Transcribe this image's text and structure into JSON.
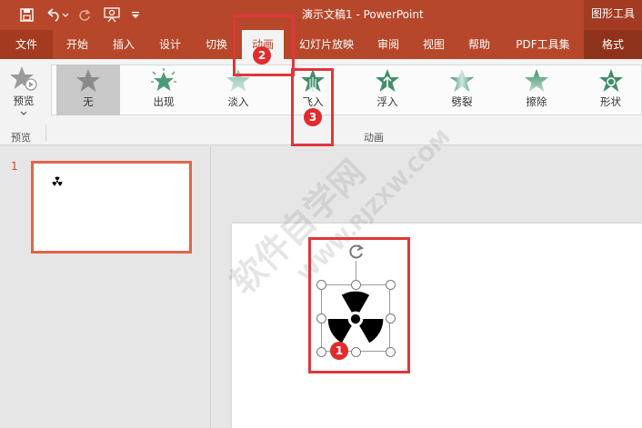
{
  "titlebar": {
    "doc_title": "演示文稿1  -  PowerPoint",
    "context_tools": "图形工具"
  },
  "qat": {
    "save_icon": "save-icon",
    "undo_icon": "undo-icon",
    "redo_icon": "redo-icon",
    "present_icon": "present-from-start-icon",
    "customize_icon": "customize-qat-icon"
  },
  "tabs": [
    {
      "label": "文件"
    },
    {
      "label": "开始"
    },
    {
      "label": "插入"
    },
    {
      "label": "设计"
    },
    {
      "label": "切换"
    },
    {
      "label": "动画"
    },
    {
      "label": "幻灯片放映"
    },
    {
      "label": "审阅"
    },
    {
      "label": "视图"
    },
    {
      "label": "帮助"
    },
    {
      "label": "PDF工具集"
    },
    {
      "label": "格式"
    }
  ],
  "ribbon": {
    "preview_label": "预览",
    "preview_group": "预览",
    "animation_group": "动画",
    "effects": [
      {
        "label": "无",
        "color": "#8a8a8a"
      },
      {
        "label": "出现",
        "color": "#4e9a78"
      },
      {
        "label": "淡入",
        "color": "#86c1a4"
      },
      {
        "label": "飞入",
        "color": "#3f8f6b"
      },
      {
        "label": "浮入",
        "color": "#3f8f6b"
      },
      {
        "label": "劈裂",
        "color": "#3f8f6b"
      },
      {
        "label": "擦除",
        "color": "#5aa383"
      },
      {
        "label": "形状",
        "color": "#3f8f6b"
      }
    ]
  },
  "slides": [
    {
      "number": "1"
    }
  ],
  "markers": {
    "m1": "1",
    "m2": "2",
    "m3": "3"
  },
  "watermark": {
    "text": "软件自学网",
    "url": "WWW.RJZXW.COM"
  },
  "colors": {
    "accent": "#b7472a",
    "highlight": "#e0363b"
  }
}
